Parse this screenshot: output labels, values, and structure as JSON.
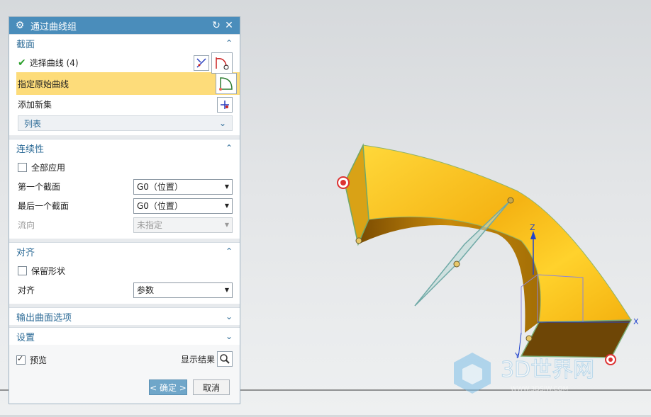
{
  "dialog": {
    "title": "通过曲线组",
    "sections": {
      "section": {
        "title": "截面",
        "select_curve_label": "选择曲线 (4)",
        "specify_origin_label": "指定原始曲线",
        "add_new_set_label": "添加新集",
        "list_label": "列表"
      },
      "continuity": {
        "title": "连续性",
        "apply_all_label": "全部应用",
        "first_section_label": "第一个截面",
        "first_section_value": "G0（位置）",
        "last_section_label": "最后一个截面",
        "last_section_value": "G0（位置）",
        "flow_label": "流向",
        "flow_value": "未指定"
      },
      "alignment": {
        "title": "对齐",
        "keep_shape_label": "保留形状",
        "align_label": "对齐",
        "align_value": "参数"
      },
      "output": {
        "title": "输出曲面选项"
      },
      "settings": {
        "title": "设置"
      }
    },
    "preview_label": "预览",
    "show_result_label": "显示结果",
    "ok_label": "< 确定 >",
    "cancel_label": "取消"
  },
  "viewport": {
    "axis_x": "X",
    "axis_y": "Y",
    "axis_z": "Z",
    "watermark_main": "3D世界网",
    "watermark_sub": "WWW.3DSJW.COM"
  },
  "colors": {
    "titlebar": "#4a8dbb",
    "section_title": "#2b6a96",
    "highlight": "#fddc7a",
    "surface_yellow": "#f7c21c",
    "surface_dark": "#8a5a06"
  }
}
